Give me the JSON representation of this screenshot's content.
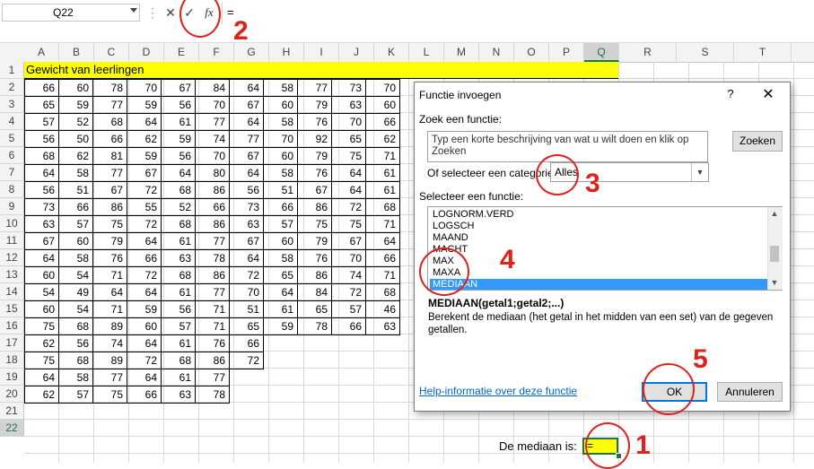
{
  "formula_bar": {
    "name_box": "Q22",
    "dots": "⋮",
    "cancel_icon": "✕",
    "enter_icon": "✓",
    "fx_label": "fx",
    "content": "="
  },
  "columns": [
    "A",
    "B",
    "C",
    "D",
    "E",
    "F",
    "G",
    "H",
    "I",
    "J",
    "K",
    "L",
    "M",
    "N",
    "O",
    "P",
    "Q",
    "R",
    "S",
    "T"
  ],
  "selected_column": "Q",
  "rows": [
    "1",
    "2",
    "3",
    "4",
    "5",
    "6",
    "7",
    "8",
    "9",
    "10",
    "11",
    "12",
    "13",
    "14",
    "15",
    "16",
    "17",
    "18",
    "19",
    "20",
    "21",
    "22"
  ],
  "selected_row": "22",
  "sheet": {
    "title": "Gewicht van leerlingen",
    "data": [
      [
        "66",
        "60",
        "78",
        "70",
        "67",
        "84",
        "64",
        "58",
        "77",
        "73",
        "70"
      ],
      [
        "65",
        "59",
        "77",
        "59",
        "56",
        "70",
        "67",
        "60",
        "79",
        "63",
        "60"
      ],
      [
        "57",
        "52",
        "68",
        "64",
        "61",
        "77",
        "64",
        "58",
        "76",
        "70",
        "66"
      ],
      [
        "56",
        "50",
        "66",
        "62",
        "59",
        "74",
        "77",
        "70",
        "92",
        "65",
        "62"
      ],
      [
        "68",
        "62",
        "81",
        "59",
        "56",
        "70",
        "67",
        "60",
        "79",
        "75",
        "71"
      ],
      [
        "64",
        "58",
        "77",
        "67",
        "64",
        "80",
        "64",
        "58",
        "76",
        "64",
        "61"
      ],
      [
        "56",
        "51",
        "67",
        "72",
        "68",
        "86",
        "56",
        "51",
        "67",
        "64",
        "61"
      ],
      [
        "73",
        "66",
        "86",
        "55",
        "52",
        "66",
        "73",
        "66",
        "86",
        "72",
        "68"
      ],
      [
        "63",
        "57",
        "75",
        "72",
        "68",
        "86",
        "63",
        "57",
        "75",
        "75",
        "71"
      ],
      [
        "67",
        "60",
        "79",
        "64",
        "61",
        "77",
        "67",
        "60",
        "79",
        "67",
        "64"
      ],
      [
        "64",
        "58",
        "76",
        "66",
        "63",
        "78",
        "64",
        "58",
        "76",
        "70",
        "66"
      ],
      [
        "60",
        "54",
        "71",
        "72",
        "68",
        "86",
        "72",
        "65",
        "86",
        "74",
        "71"
      ],
      [
        "54",
        "49",
        "64",
        "64",
        "61",
        "77",
        "70",
        "64",
        "84",
        "72",
        "68"
      ],
      [
        "60",
        "54",
        "71",
        "59",
        "56",
        "71",
        "51",
        "61",
        "65",
        "57",
        "46"
      ],
      [
        "75",
        "68",
        "89",
        "60",
        "57",
        "71",
        "65",
        "59",
        "78",
        "66",
        "63"
      ],
      [
        "62",
        "56",
        "74",
        "64",
        "61",
        "76",
        "66",
        "",
        "",
        "",
        ""
      ],
      [
        "75",
        "68",
        "89",
        "72",
        "68",
        "86",
        "72",
        "",
        "",
        "",
        ""
      ],
      [
        "64",
        "58",
        "77",
        "64",
        "61",
        "77",
        "",
        "",
        "",
        "",
        ""
      ],
      [
        "62",
        "57",
        "75",
        "66",
        "63",
        "78",
        "",
        "",
        "",
        "",
        ""
      ]
    ],
    "median_label": "De mediaan is:",
    "q22_value": "="
  },
  "annotations": [
    "1",
    "2",
    "3",
    "4",
    "5"
  ],
  "dialog": {
    "title": "Functie invoegen",
    "help": "?",
    "close": "✕",
    "search_label": "Zoek een functie:",
    "search_text": "Typ een korte beschrijving van wat u wilt doen en klik op Zoeken",
    "search_button": "Zoeken",
    "category_label": "Of selecteer een categorie:",
    "category_value": "Alles",
    "category_arrow": "▼",
    "function_label": "Selecteer een functie:",
    "functions": [
      "LOGNORM.VERD",
      "LOGSCH",
      "MAAND",
      "MACHT",
      "MAX",
      "MAXA",
      "MEDIAAN"
    ],
    "selected_function": "MEDIAAN",
    "scroll_up": "▲",
    "scroll_down": "▼",
    "syntax": "MEDIAAN(getal1;getal2;...)",
    "description": "Berekent de mediaan (het getal in het midden van een set) van de gegeven getallen.",
    "help_link": "Help-informatie over deze functie",
    "ok": "OK",
    "cancel": "Annuleren"
  },
  "colors": {
    "highlight_yellow": "#ffff00",
    "excel_green": "#217346",
    "annotation_red": "#e0201a",
    "selection_blue": "#3399ff"
  }
}
